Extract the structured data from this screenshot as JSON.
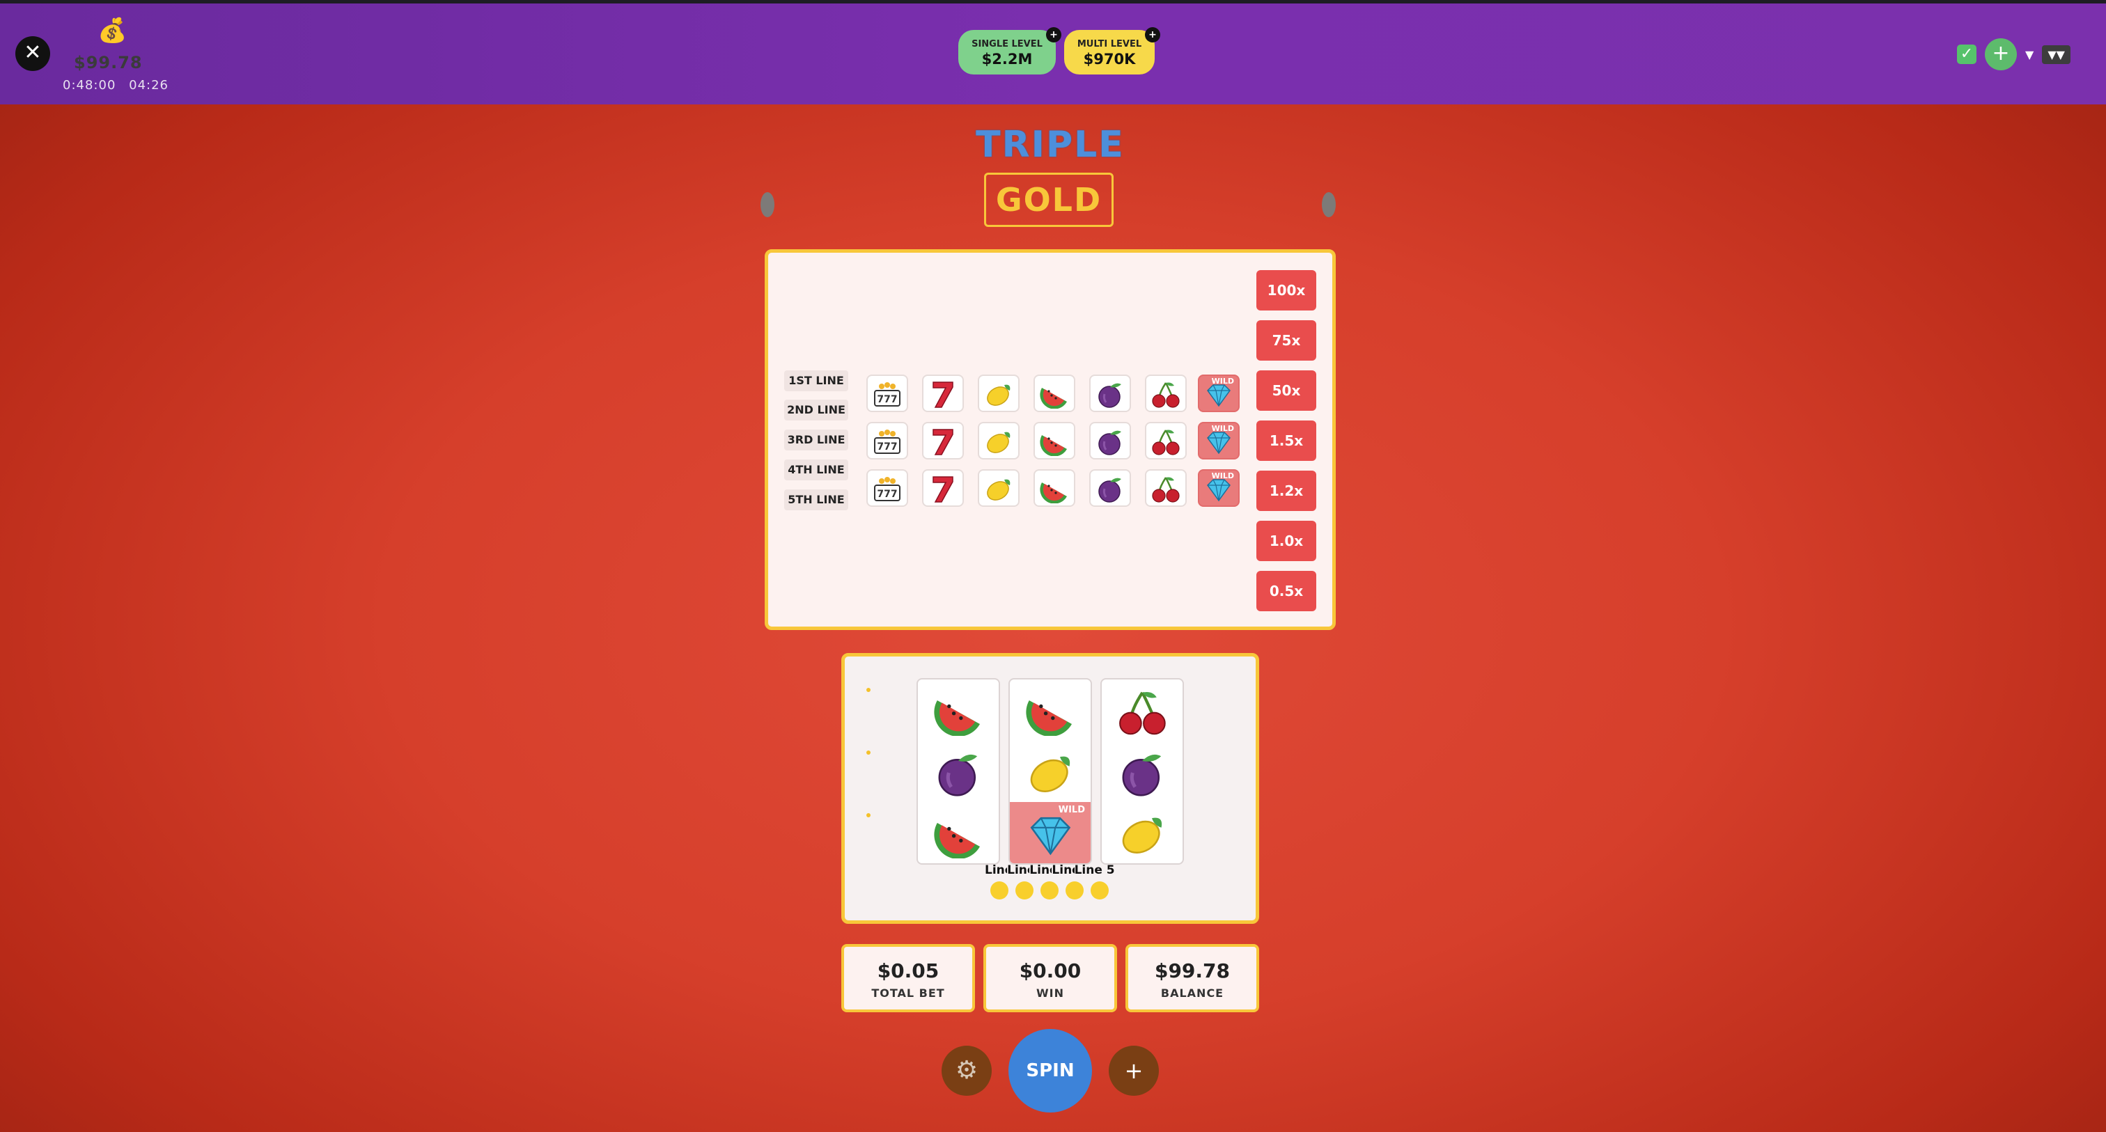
{
  "header": {
    "close_icon": "close-icon",
    "bag_icon": "money-bag-icon",
    "balance": "$99.78",
    "times": [
      "0:48:00",
      "04:26"
    ],
    "jackpots": [
      {
        "label": "SINGLE LEVEL",
        "value": "$2.2M",
        "color": "#7fd18c"
      },
      {
        "label": "MULTI LEVEL",
        "value": "$970K",
        "color": "#f7d94a"
      }
    ],
    "jackpot_plus": "+",
    "check": "✓",
    "add": "+",
    "caret": "▼",
    "double_caret": "▼▼"
  },
  "title": {
    "line1": "TRIPLE",
    "line2": "GOLD"
  },
  "paytable": {
    "lines": [
      "1ST LINE",
      "2ND LINE",
      "3RD LINE",
      "4TH LINE",
      "5TH LINE"
    ],
    "rows": [
      [
        "bar-777",
        "seven",
        "lemon",
        "watermelon",
        "plum",
        "cherry",
        "wild-diamond"
      ],
      [
        "bar-777",
        "seven",
        "lemon",
        "watermelon",
        "plum",
        "cherry",
        "wild-diamond"
      ],
      [
        "bar-777",
        "seven",
        "lemon",
        "watermelon",
        "plum",
        "cherry",
        "wild-diamond"
      ]
    ],
    "multipliers": [
      "100x",
      "75x",
      "50x",
      "1.5x",
      "1.2x",
      "1.0x",
      "0.5x"
    ],
    "wild_label": "WILD"
  },
  "reels": [
    [
      "watermelon",
      "plum",
      "watermelon"
    ],
    [
      "watermelon",
      "lemon",
      "wild-diamond"
    ],
    [
      "cherry",
      "plum",
      "lemon"
    ]
  ],
  "paylines": [
    "Line 1",
    "Line 2",
    "Line 3",
    "Line 4",
    "Line 5"
  ],
  "stats": [
    {
      "value": "$0.05",
      "label": "TOTAL BET"
    },
    {
      "value": "$0.00",
      "label": "WIN"
    },
    {
      "value": "$99.78",
      "label": "BALANCE"
    }
  ],
  "controls": {
    "settings_icon": "gear-icon",
    "spin": "SPIN",
    "plus": "+"
  },
  "colors": {
    "topbar": "#7a2fae",
    "background": "#d63f2b",
    "gold": "#f8c73a",
    "mult_red": "#e94d4d",
    "spin_blue": "#3d83d9"
  }
}
